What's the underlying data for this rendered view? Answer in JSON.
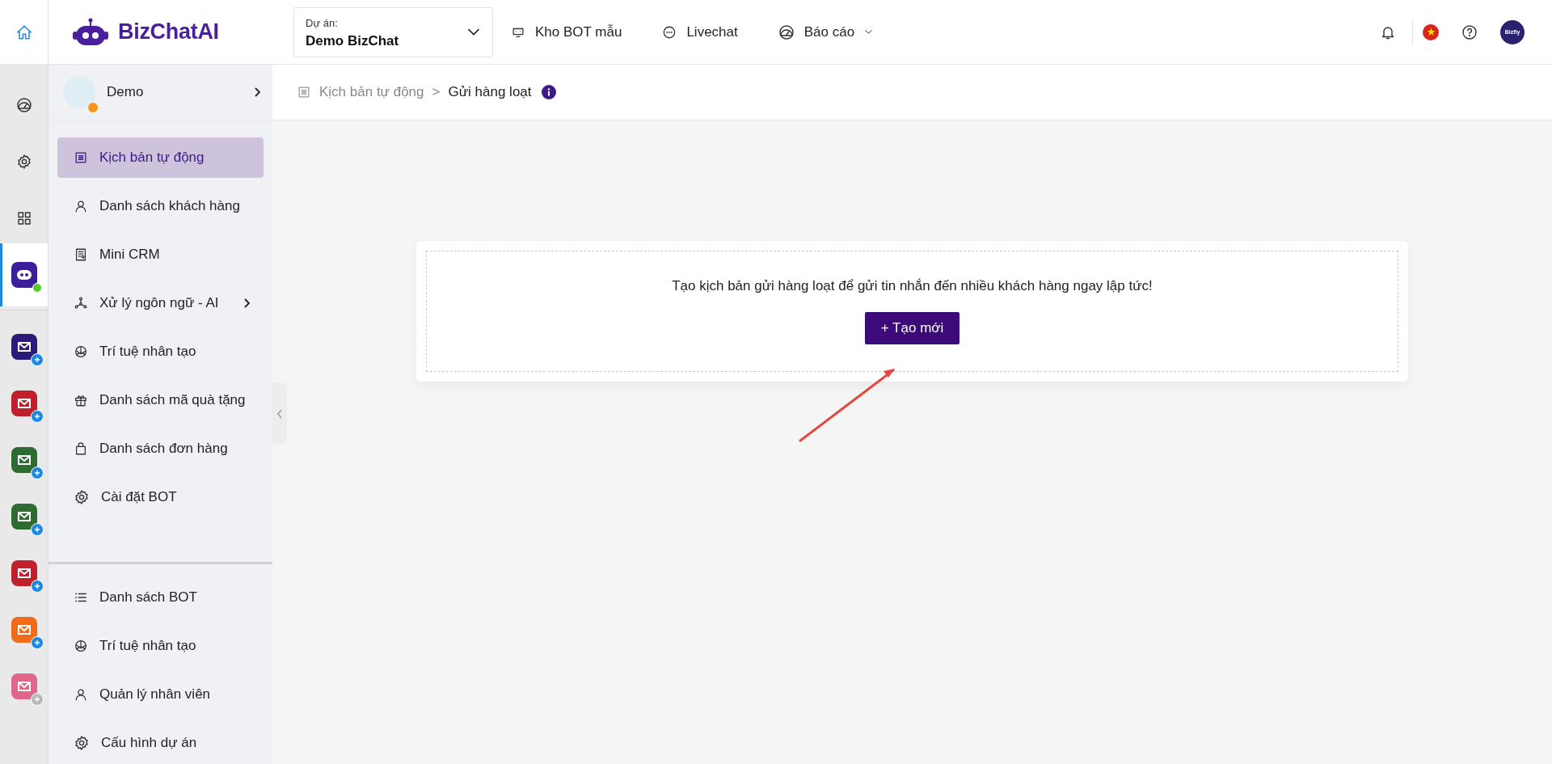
{
  "header": {
    "logo_text": "BizChatAI",
    "project": {
      "label": "Dự án:",
      "value": "Demo BizChat"
    },
    "nav": [
      {
        "label": "Kho BOT mẫu",
        "kind": "link"
      },
      {
        "label": "Livechat",
        "kind": "link"
      },
      {
        "label": "Báo cáo",
        "kind": "dropdown"
      }
    ],
    "avatar_text": "Bizfly"
  },
  "rail": {
    "items": [
      {
        "selected": false
      },
      {
        "selected": false
      },
      {
        "selected": false
      },
      {
        "selected": true
      }
    ],
    "apps": [
      {
        "disabled": false
      },
      {
        "disabled": false
      },
      {
        "disabled": false
      },
      {
        "disabled": false
      },
      {
        "disabled": false
      },
      {
        "disabled": false
      },
      {
        "disabled": true
      }
    ]
  },
  "sidebar": {
    "header": {
      "name": "Demo"
    },
    "items": [
      {
        "label": "Kịch bản tự động",
        "selected": true,
        "kind": "link"
      },
      {
        "label": "Danh sách khách hàng",
        "selected": false,
        "kind": "link"
      },
      {
        "label": "Mini CRM",
        "selected": false,
        "kind": "link"
      },
      {
        "label": "Xử lý ngôn ngữ - AI",
        "selected": false,
        "kind": "submenu"
      },
      {
        "label": "Trí tuệ nhân tạo",
        "selected": false,
        "kind": "link"
      },
      {
        "label": "Danh sách mã quà tặng",
        "selected": false,
        "kind": "link"
      },
      {
        "label": "Danh sách đơn hàng",
        "selected": false,
        "kind": "link"
      },
      {
        "label": "Cài đặt BOT",
        "selected": false,
        "kind": "link"
      }
    ],
    "bottom_items": [
      {
        "label": "Danh sách BOT",
        "selected": false
      },
      {
        "label": "Trí tuệ nhân tạo",
        "selected": false
      },
      {
        "label": "Quản lý nhân viên",
        "selected": false
      },
      {
        "label": "Cấu hình dự án",
        "selected": false
      }
    ]
  },
  "breadcrumb": [
    {
      "label": "Kịch bản tự động",
      "current": false
    },
    {
      "separator": ">"
    },
    {
      "label": "Gửi hàng loạt",
      "current": true
    }
  ],
  "empty_state": {
    "message": "Tạo kịch bản gửi hàng loạt để gửi tin nhắn đến nhiều khách hàng ngay lập tức!",
    "button": "+ Tạo mới"
  }
}
